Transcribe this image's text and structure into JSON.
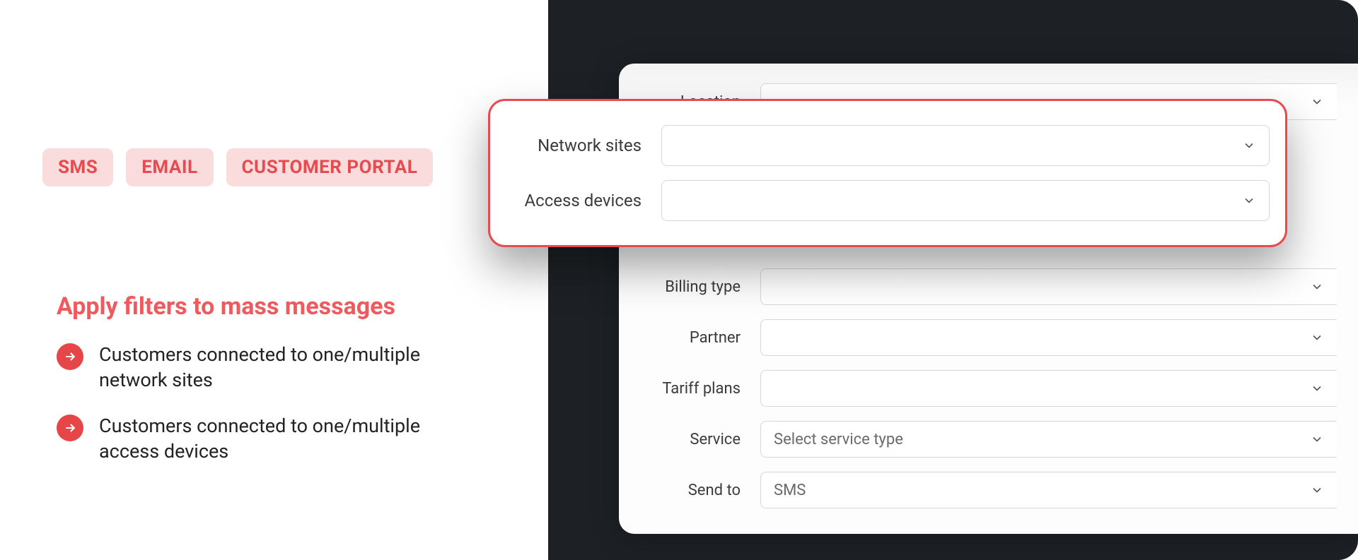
{
  "tags": {
    "sms": "SMS",
    "email": "EMAIL",
    "portal": "CUSTOMER PORTAL"
  },
  "heading": "Apply filters to mass messages",
  "bullets": {
    "b1": "Customers connected to one/multiple network sites",
    "b2": "Customers connected to one/multiple access devices"
  },
  "form": {
    "location": {
      "label": "Location",
      "value": ""
    },
    "network_sites": {
      "label": "Network sites",
      "value": ""
    },
    "access_devices": {
      "label": "Access devices",
      "value": ""
    },
    "billing_type": {
      "label": "Billing type",
      "value": ""
    },
    "partner": {
      "label": "Partner",
      "value": ""
    },
    "tariff_plans": {
      "label": "Tariff plans",
      "value": ""
    },
    "service": {
      "label": "Service",
      "value": "Select service type"
    },
    "send_to": {
      "label": "Send to",
      "value": "SMS"
    }
  }
}
